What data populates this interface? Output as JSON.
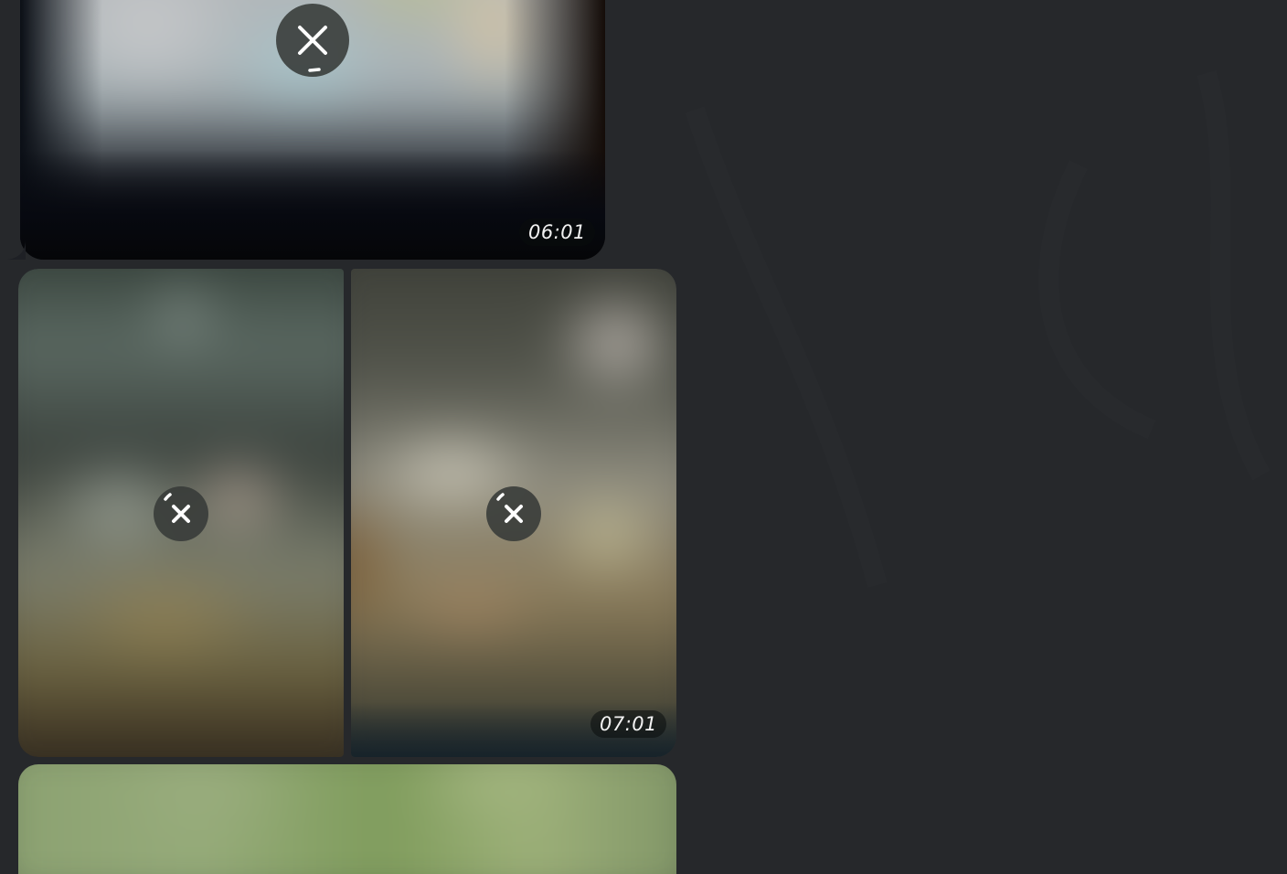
{
  "messages": [
    {
      "id": "media-1",
      "time": "06:01",
      "status": "uploading",
      "cancel_icon": "close-icon"
    },
    {
      "id": "album-1",
      "time": "07:01",
      "items": [
        {
          "status": "uploading",
          "cancel_icon": "close-icon"
        },
        {
          "status": "uploading",
          "cancel_icon": "close-icon"
        }
      ]
    },
    {
      "id": "media-3",
      "status": "loading"
    }
  ],
  "colors": {
    "background": "#26282b",
    "overlay_button": "#373a38",
    "timestamp_text": "#f2f2f2"
  }
}
